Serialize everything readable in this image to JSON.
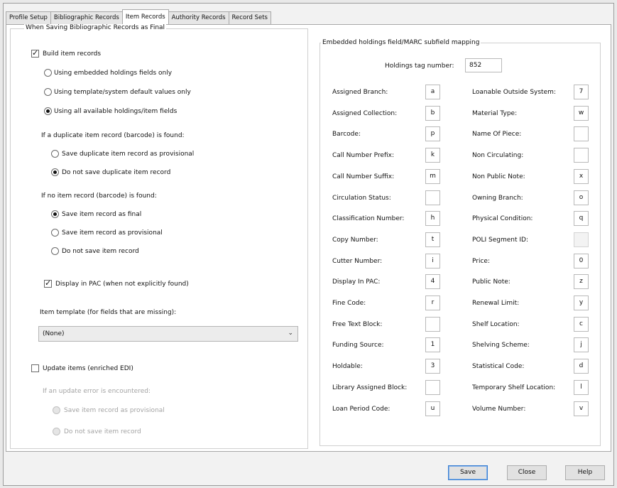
{
  "tabs": [
    {
      "label": "Profile Setup"
    },
    {
      "label": "Bibliographic Records"
    },
    {
      "label": "Item Records"
    },
    {
      "label": "Authority Records"
    },
    {
      "label": "Record Sets"
    }
  ],
  "saving_group": {
    "legend": "When Saving Bibliographic Records as Final",
    "build_item_records": {
      "label": "Build item records",
      "checked": true
    },
    "build_options": [
      {
        "label": "Using embedded holdings fields only",
        "selected": false
      },
      {
        "label": "Using template/system default values only",
        "selected": false
      },
      {
        "label": "Using all available holdings/item fields",
        "selected": true
      }
    ],
    "duplicate_heading": "If a duplicate item record (barcode) is found:",
    "duplicate_options": [
      {
        "label": "Save duplicate item record as provisional",
        "selected": false
      },
      {
        "label": "Do not save duplicate item record",
        "selected": true
      }
    ],
    "no_item_heading": "If no item record (barcode) is found:",
    "no_item_options": [
      {
        "label": "Save item record as final",
        "selected": true
      },
      {
        "label": "Save item record as provisional",
        "selected": false
      },
      {
        "label": "Do not save item record",
        "selected": false
      }
    ],
    "display_in_pac": {
      "label": "Display in PAC (when not explicitly found)",
      "checked": true
    },
    "item_template_label": "Item template (for fields that are missing):",
    "item_template_value": "(None)",
    "update_items": {
      "label": "Update items (enriched EDI)",
      "checked": false
    },
    "update_error_heading": "If an update error is encountered:",
    "update_error_options": [
      {
        "label": "Save item record as provisional",
        "selected": false
      },
      {
        "label": "Do not save item record",
        "selected": false
      }
    ]
  },
  "mapping_group": {
    "legend": "Embedded holdings field/MARC subfield mapping",
    "holdings_tag_label": "Holdings tag number:",
    "holdings_tag_value": "852",
    "left_fields": [
      {
        "label": "Assigned Branch:",
        "value": "a"
      },
      {
        "label": "Assigned Collection:",
        "value": "b"
      },
      {
        "label": "Barcode:",
        "value": "p"
      },
      {
        "label": "Call Number Prefix:",
        "value": "k"
      },
      {
        "label": "Call Number Suffix:",
        "value": "m"
      },
      {
        "label": "Circulation Status:",
        "value": ""
      },
      {
        "label": "Classification Number:",
        "value": "h"
      },
      {
        "label": "Copy Number:",
        "value": "t"
      },
      {
        "label": "Cutter Number:",
        "value": "i"
      },
      {
        "label": "Display In PAC:",
        "value": "4"
      },
      {
        "label": "Fine Code:",
        "value": "r"
      },
      {
        "label": "Free Text Block:",
        "value": ""
      },
      {
        "label": "Funding Source:",
        "value": "1"
      },
      {
        "label": "Holdable:",
        "value": "3"
      },
      {
        "label": "Library Assigned Block:",
        "value": ""
      },
      {
        "label": "Loan Period Code:",
        "value": "u"
      }
    ],
    "right_fields": [
      {
        "label": "Loanable Outside System:",
        "value": "7"
      },
      {
        "label": "Material Type:",
        "value": "w"
      },
      {
        "label": "Name Of Piece:",
        "value": ""
      },
      {
        "label": "Non Circulating:",
        "value": ""
      },
      {
        "label": "Non Public Note:",
        "value": "x"
      },
      {
        "label": "Owning Branch:",
        "value": "o"
      },
      {
        "label": "Physical Condition:",
        "value": "q"
      },
      {
        "label": "POLI Segment ID:",
        "value": "",
        "disabled": true
      },
      {
        "label": "Price:",
        "value": "0"
      },
      {
        "label": "Public Note:",
        "value": "z"
      },
      {
        "label": "Renewal Limit:",
        "value": "y"
      },
      {
        "label": "Shelf Location:",
        "value": "c"
      },
      {
        "label": "Shelving Scheme:",
        "value": "j"
      },
      {
        "label": "Statistical Code:",
        "value": "d"
      },
      {
        "label": "Temporary Shelf Location:",
        "value": "l"
      },
      {
        "label": "Volume Number:",
        "value": "v"
      }
    ]
  },
  "buttons": {
    "save": "Save",
    "close": "Close",
    "help": "Help"
  }
}
